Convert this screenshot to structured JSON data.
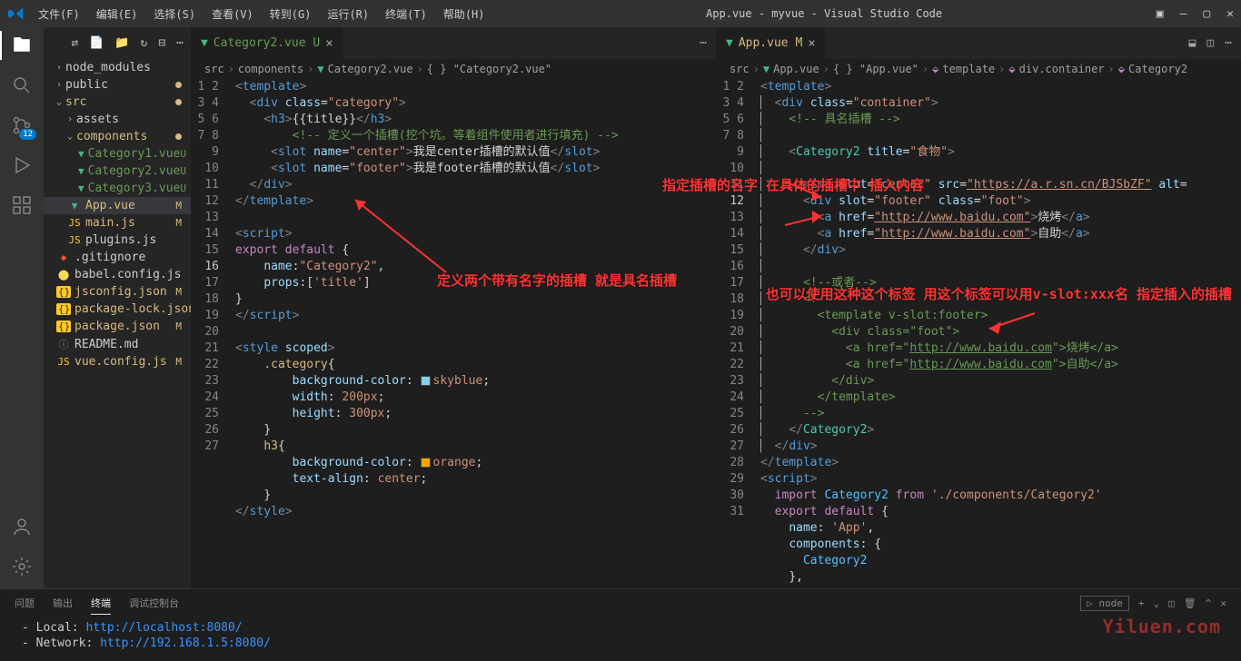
{
  "titlebar": {
    "title": "App.vue - myvue - Visual Studio Code"
  },
  "menus": [
    "文件(F)",
    "编辑(E)",
    "选择(S)",
    "查看(V)",
    "转到(G)",
    "运行(R)",
    "终端(T)",
    "帮助(H)"
  ],
  "activity_badge": "12",
  "tree": {
    "node_modules": "node_modules",
    "public": "public",
    "src": "src",
    "assets": "assets",
    "components": "components",
    "files": {
      "cat1": "Category1.vue",
      "cat2": "Category2.vue",
      "cat3": "Category3.vue",
      "app": "App.vue",
      "main": "main.js",
      "plugins": "plugins.js",
      "gitignore": ".gitignore",
      "babel": "babel.config.js",
      "jsconfig": "jsconfig.json",
      "pkglock": "package-lock.json",
      "pkg": "package.json",
      "readme": "README.md",
      "vueconfig": "vue.config.js"
    },
    "status": {
      "U": "U",
      "M": "M"
    }
  },
  "tabs": {
    "left": {
      "name": "Category2.vue",
      "status": "U"
    },
    "right": {
      "name": "App.vue",
      "status": "M"
    }
  },
  "breadcrumbs": {
    "left": [
      "src",
      "components",
      "Category2.vue",
      "{ } \"Category2.vue\""
    ],
    "right": [
      "src",
      "App.vue",
      "{ } \"App.vue\"",
      "template",
      "div.container",
      "Category2"
    ]
  },
  "left_code": {
    "l1": "<template>",
    "l2_a": "div",
    "l2_b": "class",
    "l2_c": "\"category\"",
    "l3_a": "h3",
    "l3_b": "{{title}}",
    "l4_c": "<!-- 定义一个插槽(挖个坑。等着组件使用者进行填充) -->",
    "l5_a": "slot",
    "l5_b": "name",
    "l5_c": "\"center\"",
    "l5_d": "我是center插槽的默认值",
    "l6_a": "slot",
    "l6_b": "name",
    "l6_c": "\"footer\"",
    "l6_d": "我是footer插槽的默认值",
    "l10": "<script>",
    "l11_a": "export",
    "l11_b": "default",
    "l12_a": "name",
    "l12_b": "\"Category2\"",
    "l13_a": "props",
    "l13_b": "'title'",
    "l15": "</script>",
    "l17": "<style",
    "l17b": "scoped",
    "l18": ".category",
    "l19_a": "background-color",
    "l19_b": "skyblue",
    "l20_a": "width",
    "l20_b": "200px",
    "l21_a": "height",
    "l21_b": "300px",
    "l23": "h3",
    "l24_a": "background-color",
    "l24_b": "orange",
    "l25_a": "text-align",
    "l25_b": "center",
    "l27": "</style>"
  },
  "right_code": {
    "l1": "<template>",
    "l2_a": "div",
    "l2_b": "class",
    "l2_c": "\"container\"",
    "l3_c": "<!-- 具名插槽 -->",
    "l5_a": "Category2",
    "l5_b": "title",
    "l5_c": "\"食物\"",
    "l7_a": "img",
    "l7_b": "slot",
    "l7_c": "\"center\"",
    "l7_d": "src",
    "l7_e": "\"https://a.r.sn.cn/BJSbZF\"",
    "l7_f": "alt",
    "l8_a": "div",
    "l8_b": "slot",
    "l8_c": "\"footer\"",
    "l8_d": "class",
    "l8_e": "\"foot\"",
    "l9_a": "a",
    "l9_b": "href",
    "l9_c": "\"http://www.baidu.com\"",
    "l9_d": "烧烤",
    "l10_a": "a",
    "l10_b": "href",
    "l10_c": "\"http://www.baidu.com\"",
    "l10_d": "自助",
    "l13_c": "<!--或者-->",
    "l14_c": "<!--",
    "l15_c": "<template v-slot:footer>",
    "l16_c": "<div class=\"foot\">",
    "l17_c": "<a href=\"http://www.baidu.com\">烧烤</a>",
    "l18_c": "<a href=\"http://www.baidu.com\">自助</a>",
    "l19_c": "</div>",
    "l20_c": "</template>",
    "l21_c": "-->",
    "l25": "<script>",
    "l26_a": "import",
    "l26_b": "Category2",
    "l26_c": "from",
    "l26_d": "'./components/Category2'",
    "l27_a": "export",
    "l27_b": "default",
    "l28_a": "name",
    "l28_b": "'App'",
    "l29": "components",
    "l30": "Category2"
  },
  "annotations": {
    "left": "定义两个带有名字的插槽\n就是具名插槽",
    "mid": "指定插槽的名字\n在具体的插槽中\n插入内容",
    "right": "也可以使用这种这个标签\n用这个标签可以用v-slot:xxx名\n指定插入的插槽"
  },
  "panel": {
    "tabs": [
      "问题",
      "输出",
      "终端",
      "调试控制台"
    ],
    "node": "node",
    "local_lbl": "- Local:   ",
    "net_lbl": "- Network: ",
    "local": "http://localhost:8080/",
    "network": "http://192.168.1.5:8080/"
  },
  "watermark": "Yiluen.com"
}
